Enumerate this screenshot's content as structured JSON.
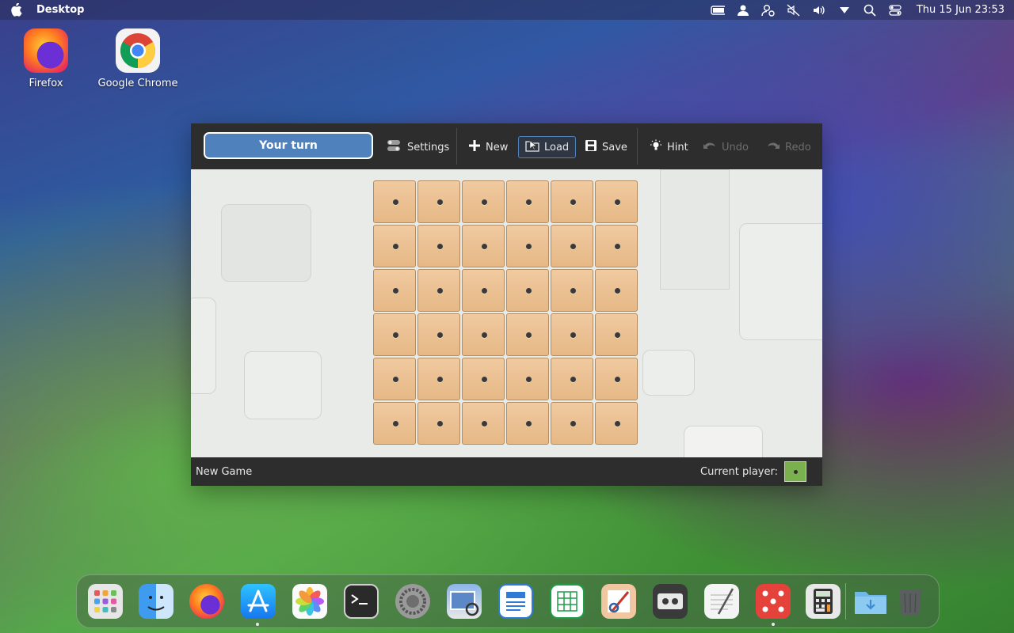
{
  "menubar": {
    "app_title": "Desktop",
    "clock": "Thu 15 Jun 23:53",
    "icons": [
      "battery-icon",
      "user-icon",
      "user-settings-icon",
      "mute-icon",
      "volume-icon",
      "chevron-down-icon",
      "search-icon",
      "control-center-icon"
    ]
  },
  "desktop_icons": [
    {
      "label": "Firefox",
      "icon": "firefox-icon"
    },
    {
      "label": "Google Chrome",
      "icon": "chrome-icon"
    }
  ],
  "game": {
    "turn_label": "Your turn",
    "toolbar": {
      "settings": "Settings",
      "new": "New",
      "load": "Load",
      "save": "Save",
      "hint": "Hint",
      "undo": "Undo",
      "redo": "Redo"
    },
    "board": {
      "rows": 6,
      "cols": 6
    },
    "status": "New Game",
    "current_player_label": "Current player:",
    "current_player_color": "#7ab04e",
    "tile_color": "#e9bb8a",
    "accent_color": "#4f81bd"
  },
  "dock": {
    "items": [
      "launchpad-icon",
      "finder-icon",
      "firefox-icon",
      "app-store-icon",
      "photos-icon",
      "terminal-icon",
      "system-settings-icon",
      "preview-icon",
      "document-viewer-icon",
      "spreadsheet-icon",
      "paint-icon",
      "tape-icon",
      "text-editor-icon",
      "dice-game-icon",
      "calculator-icon",
      "downloads-folder-icon",
      "trash-icon"
    ],
    "running": [
      "app-store-icon",
      "dice-game-icon"
    ]
  }
}
